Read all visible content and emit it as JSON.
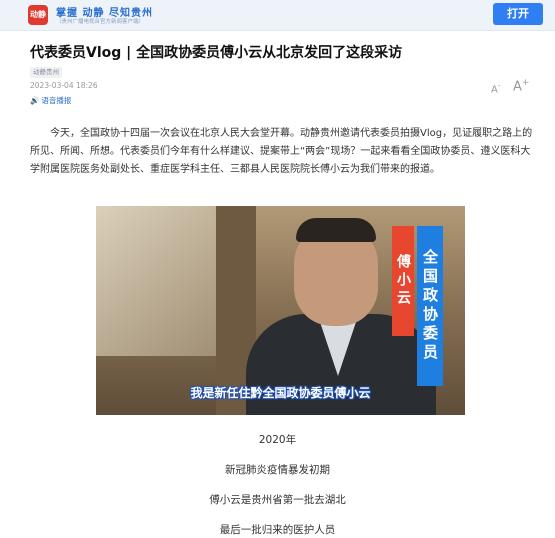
{
  "banner": {
    "logo_text": "动静",
    "slogan": "掌握 动静  尽知贵州",
    "slogan_sub": "（贵州广播电视台官方新闻客户端）",
    "open_label": "打开"
  },
  "article": {
    "title": "代表委员Vlog | 全国政协委员傅小云从北京发回了这段采访",
    "source": "动静贵州",
    "date": "2023-03-04 18:26",
    "audio_label": "语音播报",
    "font_small": "A",
    "font_small_sup": "-",
    "font_large": "A",
    "font_large_sup": "+",
    "paragraph": "今天，全国政协十四届一次会议在北京人民大会堂开幕。动静贵州邀请代表委员拍摄Vlog，见证履职之路上的所见、所闻、所想。代表委员们今年有什么样建议、提案带上“两会”现场？一起来看看全国政协委员、遵义医科大学附属医院医务处副处长、重症医学科主任、三都县人民医院院长傅小云为我们带来的报道。"
  },
  "video": {
    "name_tag": "傅小云",
    "title_tag": "全国政协委员",
    "subtitle": "我是新任住黔全国政协委员傅小云"
  },
  "captions": [
    "2020年",
    "新冠肺炎疫情暴发初期",
    "傅小云是贵州省第一批去湖北",
    "最后一批归来的医护人员"
  ],
  "colors": {
    "accent": "#2f7ff2",
    "name_tag_bg": "#e7462f",
    "title_tag_bg": "#1f7fe0"
  }
}
